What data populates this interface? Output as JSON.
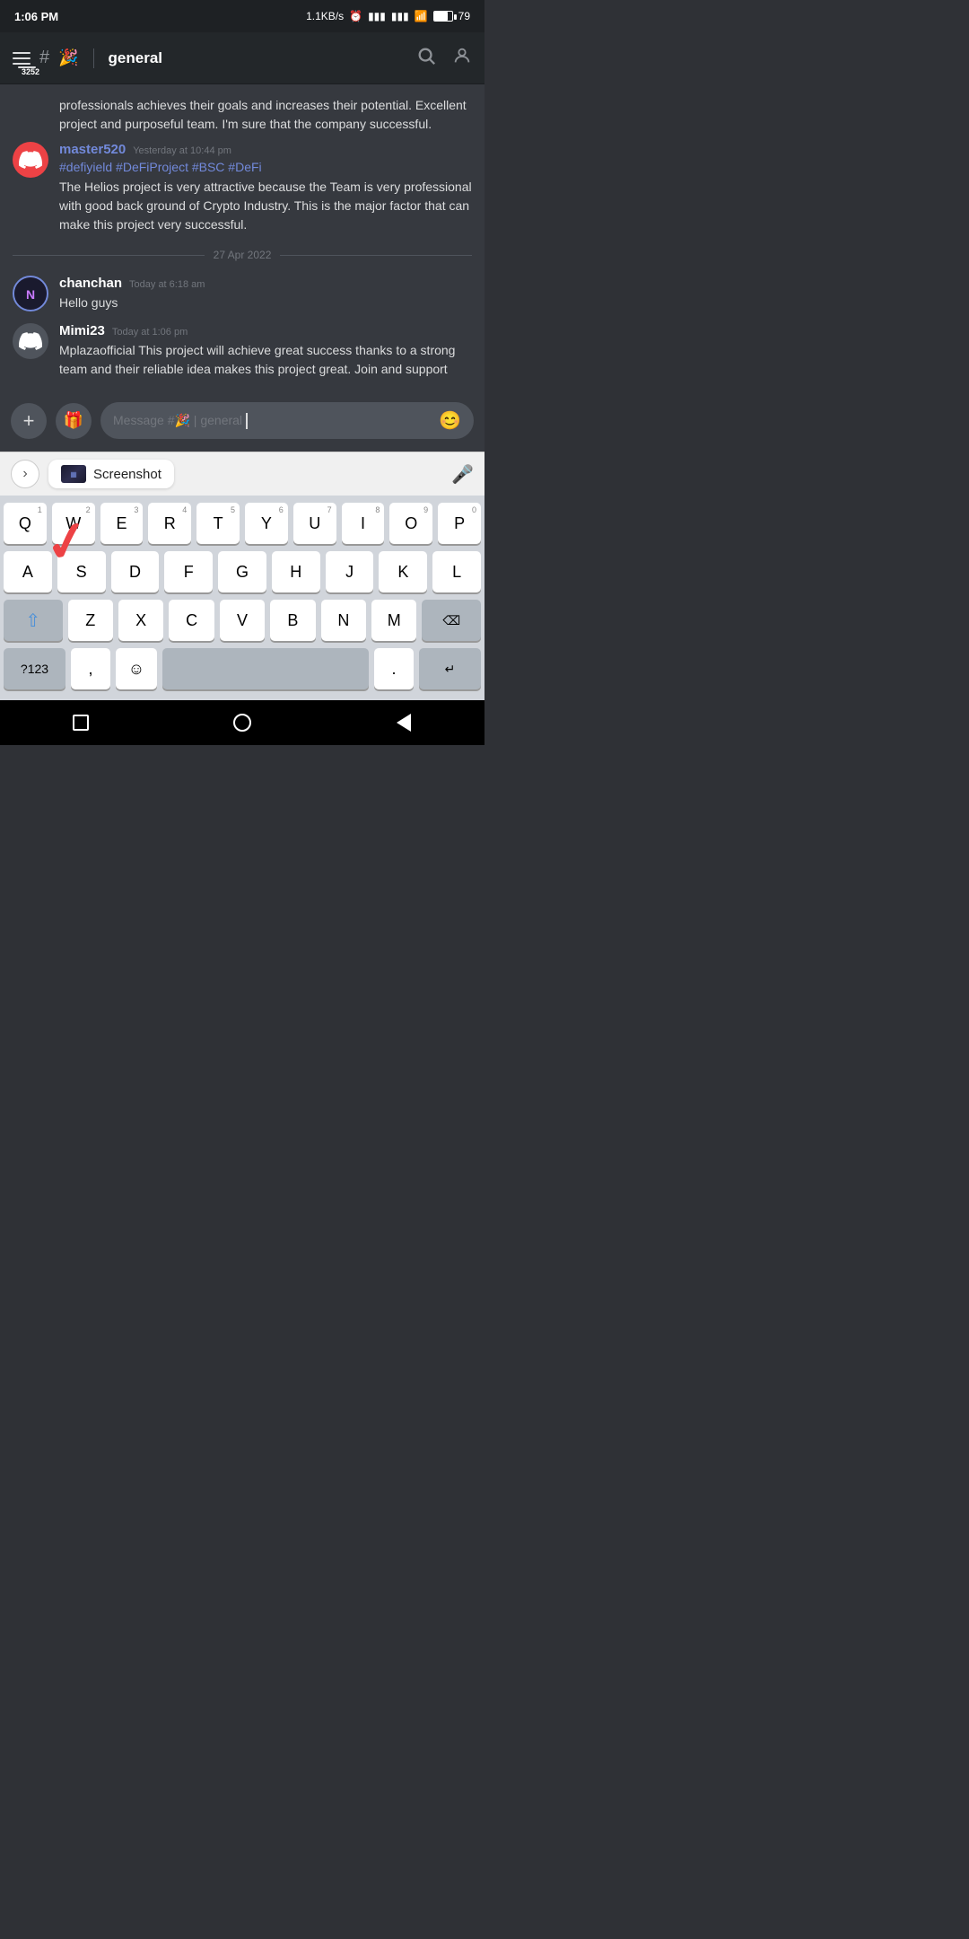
{
  "statusBar": {
    "time": "1:06 PM",
    "speed": "1.1KB/s",
    "battery": "79"
  },
  "header": {
    "badge": "3252",
    "channelEmoji": "🎉",
    "channelName": "general",
    "searchLabel": "search",
    "profileLabel": "profile"
  },
  "messages": [
    {
      "id": "msg1",
      "type": "continued",
      "text": "professionals achieves their goals and increases their potential. Excellent project and purposeful team. I'm sure that the company successful."
    },
    {
      "id": "msg2",
      "type": "group",
      "avatarType": "discord-red",
      "username": "master520",
      "usernameColor": "#7289da",
      "timestamp": "Yesterday at 10:44 pm",
      "hashtags": "#defiyield #DeFiProject #BSC #DeFi",
      "text": "The Helios project is very attractive because the Team is very professional with good back ground of Crypto Industry. This is the major factor that can make this project very successful."
    },
    {
      "id": "divider1",
      "type": "divider",
      "text": "27 Apr 2022"
    },
    {
      "id": "msg3",
      "type": "group",
      "avatarType": "gaming",
      "username": "chanchan",
      "usernameColor": "#fff",
      "timestamp": "Today at 6:18 am",
      "text": "Hello guys"
    },
    {
      "id": "msg4",
      "type": "group",
      "avatarType": "discord-gray",
      "username": "Mimi23",
      "usernameColor": "#fff",
      "timestamp": "Today at 1:06 pm",
      "text": "Mplazaofficial This project will achieve great success thanks to a strong team and their reliable idea makes this project great. Join and support"
    }
  ],
  "inputBar": {
    "addLabel": "+",
    "giftEmoji": "🎁",
    "placeholder": "Message #🎉 | general",
    "emojiLabel": "😊"
  },
  "autocomplete": {
    "chevron": "›",
    "suggestionText": "Screenshot",
    "micLabel": "mic"
  },
  "keyboard": {
    "row1": [
      {
        "key": "Q",
        "num": "1"
      },
      {
        "key": "W",
        "num": "2"
      },
      {
        "key": "E",
        "num": "3"
      },
      {
        "key": "R",
        "num": "4"
      },
      {
        "key": "T",
        "num": "5"
      },
      {
        "key": "Y",
        "num": "6"
      },
      {
        "key": "U",
        "num": "7"
      },
      {
        "key": "I",
        "num": "8"
      },
      {
        "key": "O",
        "num": "9"
      },
      {
        "key": "P",
        "num": "0"
      }
    ],
    "row2": [
      {
        "key": "A"
      },
      {
        "key": "S"
      },
      {
        "key": "D"
      },
      {
        "key": "F"
      },
      {
        "key": "G"
      },
      {
        "key": "H"
      },
      {
        "key": "J"
      },
      {
        "key": "K"
      },
      {
        "key": "L"
      }
    ],
    "row3": [
      {
        "key": "⇧",
        "special": true,
        "blue": true
      },
      {
        "key": "Z"
      },
      {
        "key": "X"
      },
      {
        "key": "C"
      },
      {
        "key": "V"
      },
      {
        "key": "B"
      },
      {
        "key": "N"
      },
      {
        "key": "M"
      },
      {
        "key": "⌫",
        "special": true
      }
    ],
    "row4": [
      {
        "key": "?123",
        "special": true
      },
      {
        "key": ","
      },
      {
        "key": "☺"
      },
      {
        "key": "",
        "space": true,
        "label": ""
      },
      {
        "key": "."
      },
      {
        "key": "↵",
        "special": true
      }
    ]
  },
  "navBar": {
    "squareLabel": "recent-apps",
    "circleLabel": "home",
    "triangleLabel": "back"
  }
}
